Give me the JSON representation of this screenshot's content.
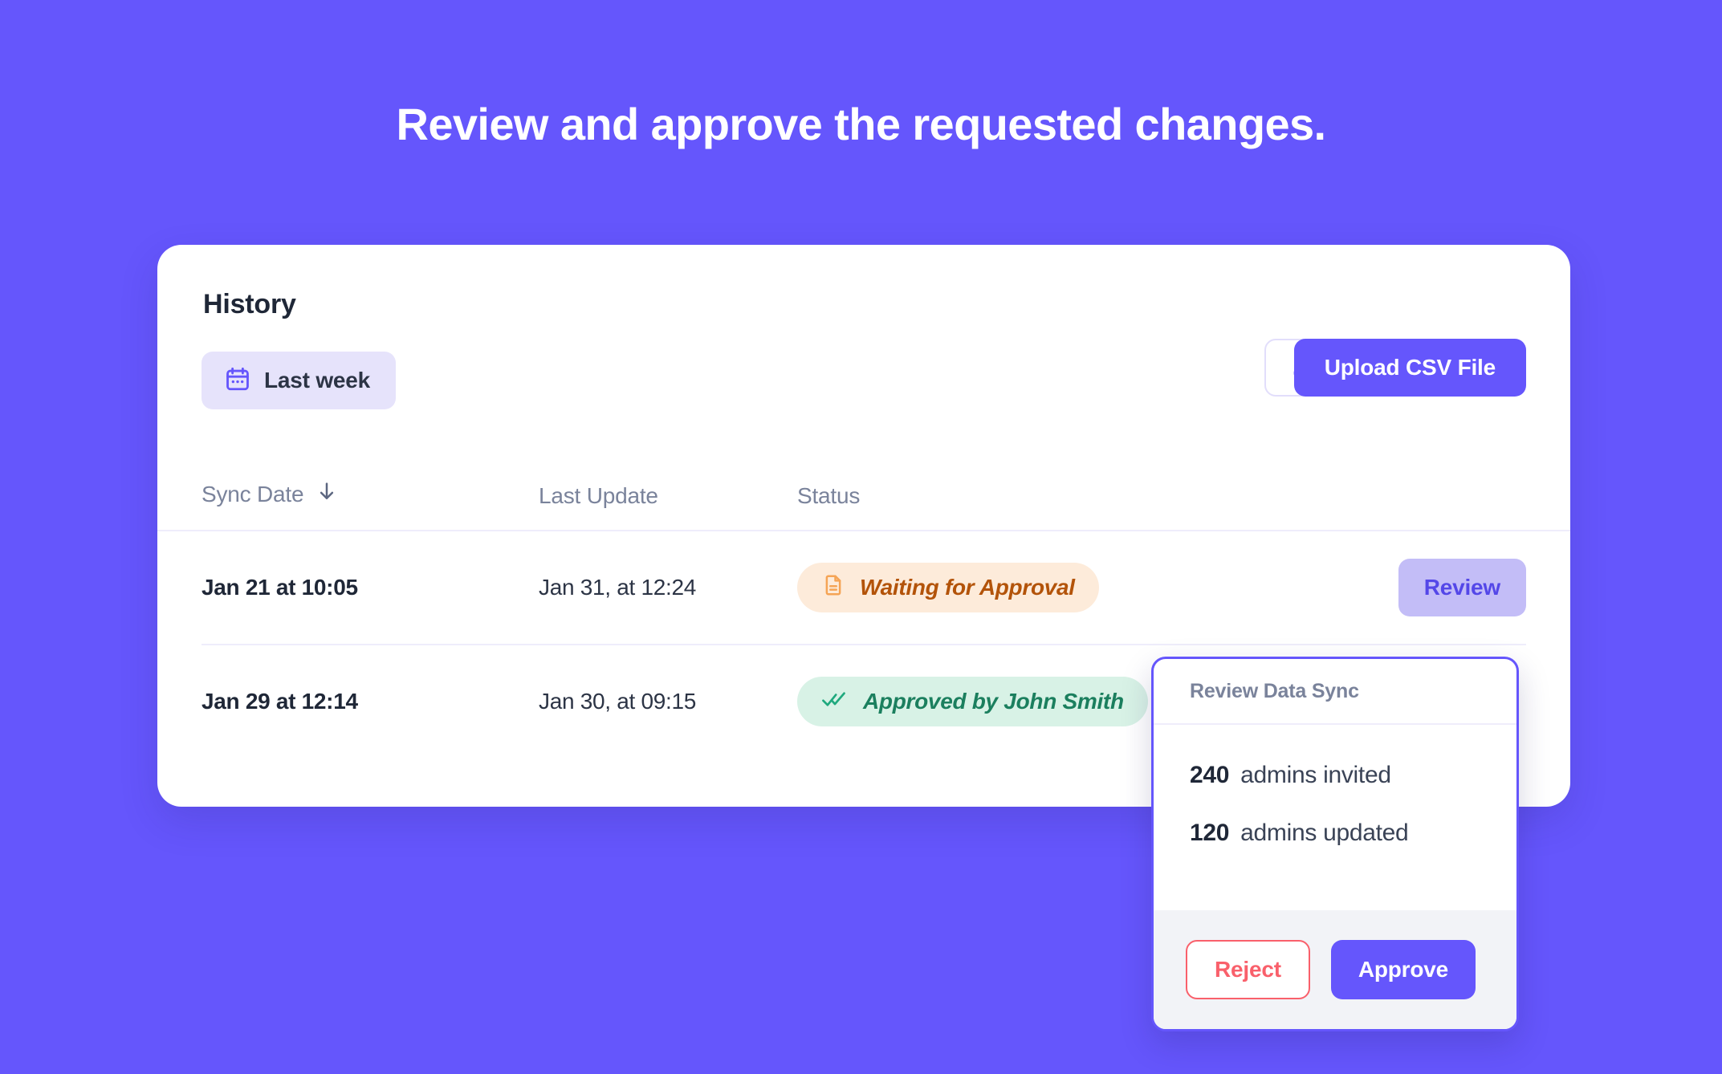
{
  "headline": "Review and approve the requested changes.",
  "theme": {
    "background": "#6556FC",
    "accent": "#6556FC",
    "chip_bg": "#E6E3FB",
    "waiting_bg": "#FDEBDA",
    "waiting_fg": "#B35309",
    "approved_bg": "#D8F2E6",
    "approved_fg": "#1B7F5E",
    "reject_fg": "#F9606B"
  },
  "card": {
    "title": "History",
    "toolbar": {
      "filter_chip": {
        "label": "Last week",
        "icon": "calendar-icon"
      },
      "download_icon": "download-icon",
      "upload_label": "Upload CSV File"
    },
    "table": {
      "columns": [
        "Sync Date",
        "Last Update",
        "Status"
      ],
      "sort_icon": "arrow-down-icon",
      "rows": [
        {
          "sync_date": "Jan 21 at 10:05",
          "last_update": "Jan 31, at 12:24",
          "status": "Waiting for Approval",
          "status_kind": "waiting",
          "status_icon": "document-icon",
          "action": "Review"
        },
        {
          "sync_date": "Jan 29 at 12:14",
          "last_update": "Jan 30, at 09:15",
          "status": "Approved by John Smith",
          "status_kind": "approved",
          "status_icon": "double-check-icon",
          "action": ""
        }
      ]
    }
  },
  "popover": {
    "title": "Review Data Sync",
    "stats": [
      {
        "value": "240",
        "label": "admins invited"
      },
      {
        "value": "120",
        "label": "admins updated"
      }
    ],
    "reject_label": "Reject",
    "approve_label": "Approve"
  }
}
